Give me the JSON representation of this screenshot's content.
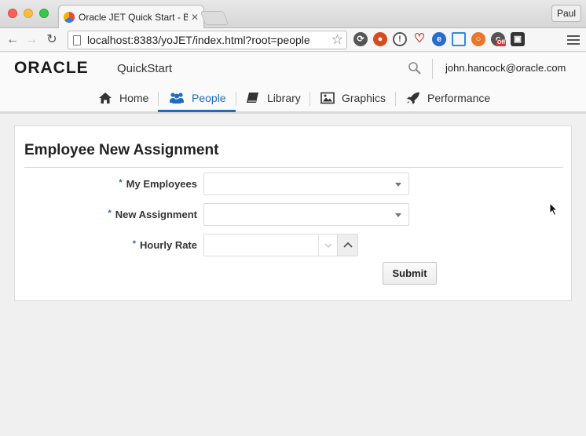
{
  "browser": {
    "tab_title": "Oracle JET Quick Start - Ba",
    "profile": "Paul",
    "url": "localhost:8383/yoJET/index.html?root=people",
    "extensions": [
      {
        "icon": "sync-icon",
        "color": "#555555"
      },
      {
        "icon": "ublock-icon",
        "color": "#d64b1f"
      },
      {
        "icon": "onepassword-icon",
        "color": "#555555"
      },
      {
        "icon": "heart-icon",
        "color": "#c0392b"
      },
      {
        "icon": "e-icon",
        "color": "#2a6bd1"
      },
      {
        "icon": "window-icon",
        "color": "#3a87d6"
      },
      {
        "icon": "lifebuoy-icon",
        "color": "#e8762c"
      },
      {
        "icon": "cookie-icon",
        "color": "#555555"
      },
      {
        "icon": "ghostery-icon",
        "color": "#333333"
      }
    ],
    "cookie_badge": "Off"
  },
  "app": {
    "brand": "ORACLE",
    "brand_sub": "QuickStart",
    "user": "john.hancock@oracle.com",
    "nav": [
      {
        "label": "Home",
        "icon": "home-icon"
      },
      {
        "label": "People",
        "icon": "people-icon",
        "active": true
      },
      {
        "label": "Library",
        "icon": "book-icon"
      },
      {
        "label": "Graphics",
        "icon": "image-icon"
      },
      {
        "label": "Performance",
        "icon": "rocket-icon"
      }
    ],
    "accent": "#1f6bc0"
  },
  "form": {
    "title": "Employee New Assignment",
    "required_mark": "*",
    "my_employees_label": "My Employees",
    "my_employees_value": "",
    "new_assignment_label": "New Assignment",
    "new_assignment_value": "",
    "hourly_rate_label": "Hourly Rate",
    "hourly_rate_value": "",
    "submit_label": "Submit"
  }
}
